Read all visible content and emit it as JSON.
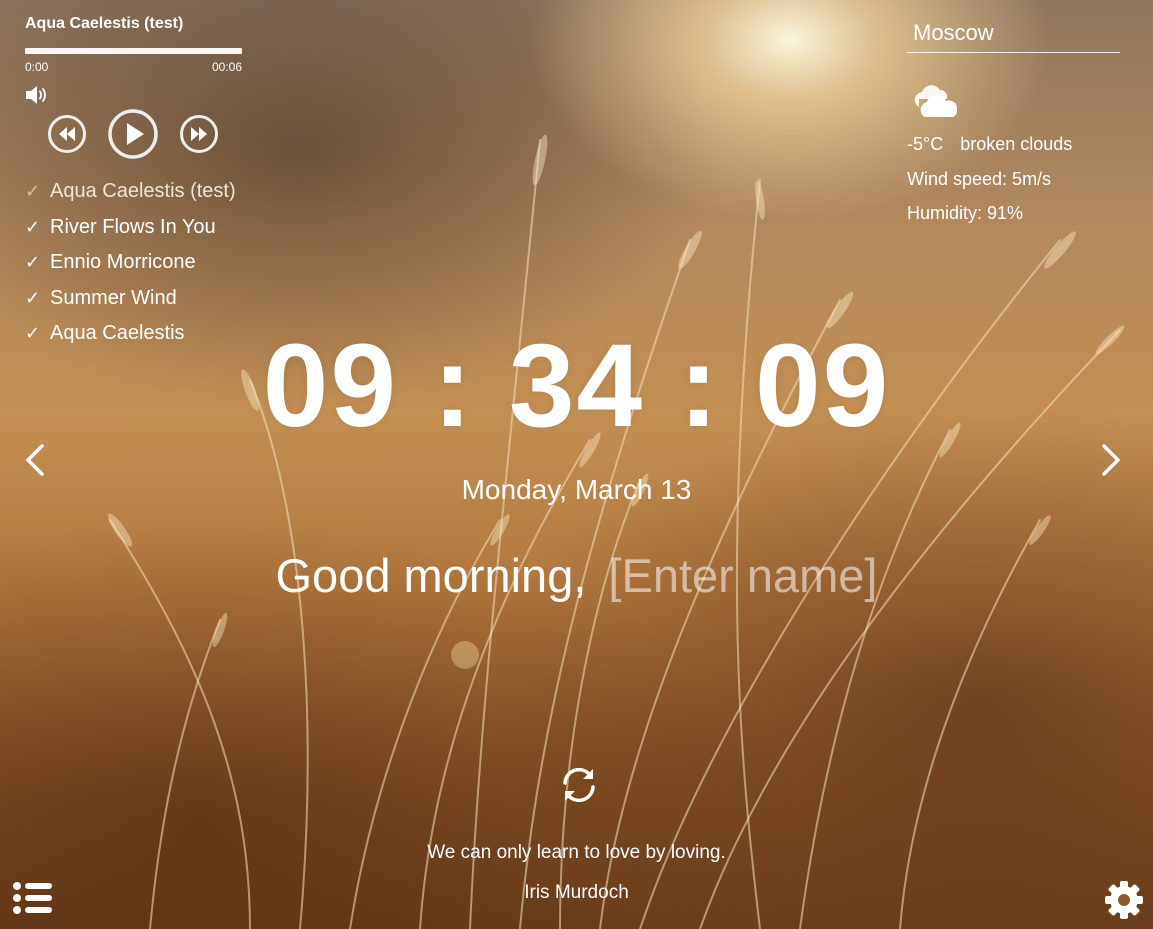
{
  "player": {
    "track_title": "Aqua Caelestis (test)",
    "progress": 1.0,
    "current_time": "0:00",
    "duration": "00:06",
    "volume_icon": "speaker-icon",
    "controls": [
      "rewind-icon",
      "play-icon",
      "fast-forward-icon"
    ],
    "playlist": [
      {
        "title": "Aqua Caelestis (test)",
        "active": true
      },
      {
        "title": "River Flows In You",
        "active": false
      },
      {
        "title": "Ennio Morricone",
        "active": false
      },
      {
        "title": "Summer Wind",
        "active": false
      },
      {
        "title": "Aqua Caelestis",
        "active": false
      }
    ],
    "check_glyph": "✓"
  },
  "weather": {
    "city": "Moscow",
    "icon": "broken-clouds-icon",
    "temperature": "-5°C",
    "description": "broken clouds",
    "wind": "Wind speed: 5m/s",
    "humidity": "Humidity: 91%"
  },
  "clock": {
    "time": "09 : 34 : 09",
    "date": "Monday, March 13"
  },
  "greeting": {
    "text": "Good morning,",
    "name_placeholder": "[Enter name]"
  },
  "quote": {
    "text": "We can only learn to love by loving.",
    "author": "Iris Murdoch"
  },
  "icons": {
    "prev": "chevron-left-icon",
    "next": "chevron-right-icon",
    "refresh": "refresh-icon",
    "playlist": "list-icon",
    "settings": "gear-icon"
  },
  "colors": {
    "text": "#ffffff",
    "active_check": "#d9c389",
    "placeholder": "rgba(255,255,255,0.55)"
  }
}
